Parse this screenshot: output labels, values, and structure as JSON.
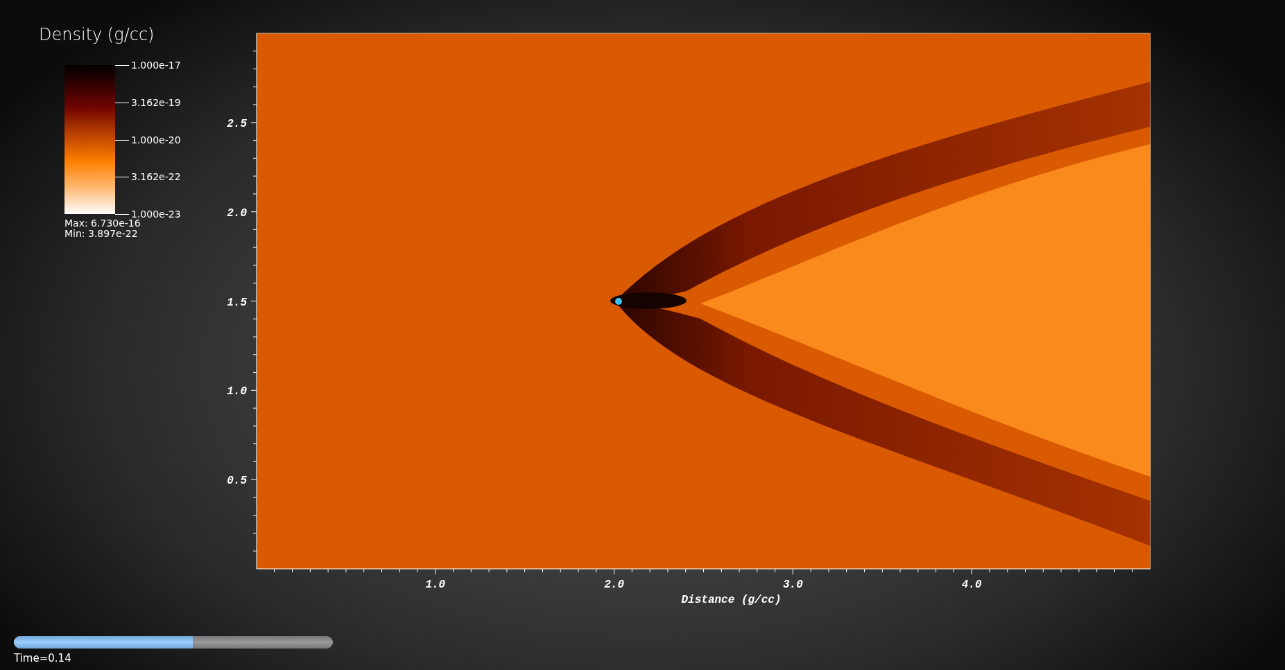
{
  "legend": {
    "title": "Density (g/cc)",
    "ticks": [
      "1.000e-17",
      "3.162e-19",
      "1.000e-20",
      "3.162e-22",
      "1.000e-23"
    ],
    "max": "Max:  6.730e-16",
    "min": "Min:  3.897e-22"
  },
  "plot": {
    "xlabel": "Distance (g/cc)",
    "x_ticks": [
      "1.0",
      "2.0",
      "3.0",
      "4.0"
    ],
    "y_ticks": [
      "2.5",
      "2.0",
      "1.5",
      "1.0",
      "0.5"
    ]
  },
  "time_slider": {
    "level": 0.56,
    "label": "Time=0.14"
  }
}
